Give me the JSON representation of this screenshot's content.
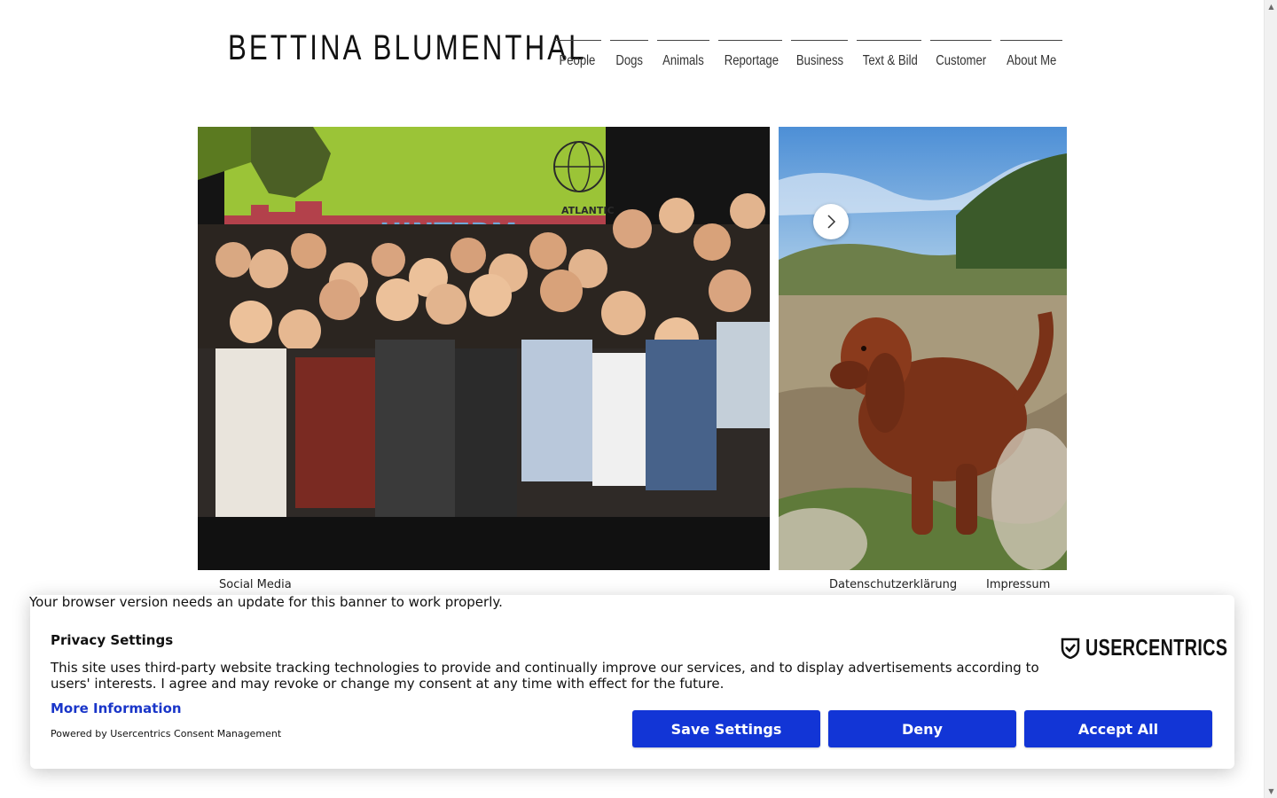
{
  "site": {
    "title": "BETTINA BLUMENTHAL"
  },
  "nav": {
    "items": [
      "People",
      "Dogs",
      "Animals",
      "Reportage",
      "Business",
      "Text & Bild",
      "Customer",
      "About Me"
    ]
  },
  "gallery": {
    "slide_1_banner_text": "HINTERM",
    "slide_1_sign_text": "ATLANTIC",
    "next_icon": "chevron-right-icon"
  },
  "footer": {
    "social": "Social Media",
    "privacy": "Datenschutzerklärung",
    "imprint": "Impressum"
  },
  "consent": {
    "update_message": "Your browser version needs an update for this banner to work properly.",
    "title": "Privacy Settings",
    "text": "This site uses third-party website tracking technologies to provide and continually improve our services, and to display advertisements according to users' interests. I agree and may revoke or change my consent at any time with effect for the future.",
    "more_info": "More Information",
    "powered_by": "Powered by Usercentrics Consent Management",
    "logo_text": "USERCENTRICS",
    "buttons": {
      "save": "Save Settings",
      "deny": "Deny",
      "accept": "Accept All"
    },
    "accent_color": "#1235d6",
    "link_color": "#1a36c9"
  }
}
